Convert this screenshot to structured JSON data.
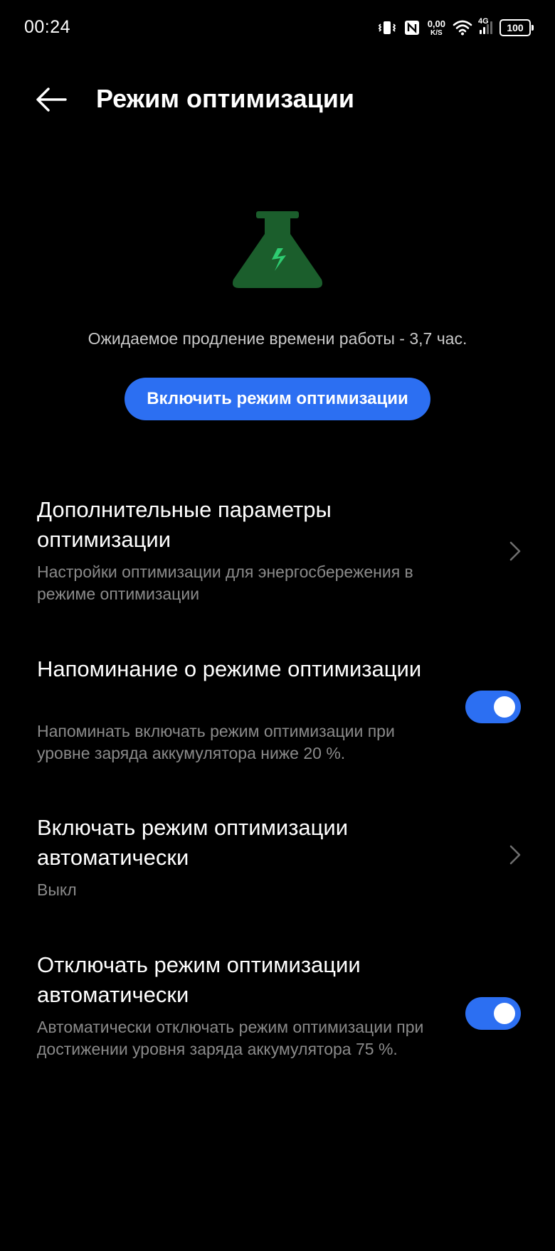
{
  "status_bar": {
    "time": "00:24",
    "net_speed_value": "0,00",
    "net_speed_unit": "K/S",
    "network_type": "4G",
    "battery_level": "100",
    "icons": [
      "vibrate-icon",
      "nfc-icon",
      "wifi-icon",
      "cellular-signal-icon",
      "battery-icon"
    ]
  },
  "header": {
    "title": "Режим оптимизации",
    "back_icon": "arrow-left-icon"
  },
  "hero": {
    "icon": "flask-bolt-icon",
    "icon_color": "#1b5e2c",
    "bolt_color": "#2ecc71",
    "description": "Ожидаемое продление времени работы - 3,7 час.",
    "button_label": "Включить режим оптимизации",
    "accent_color": "#2c6ff2"
  },
  "settings": [
    {
      "title": "Дополнительные параметры оптимизации",
      "subtitle": "Настройки оптимизации для энергосбережения в режиме оптимизации",
      "control": "chevron"
    },
    {
      "title": "Напоминание о режиме оптимизации",
      "subtitle": "Напоминать включать режим оптимизации при уровне заряда аккумулятора ниже 20 %.",
      "control": "toggle",
      "enabled": true
    },
    {
      "title": "Включать режим оптимизации автоматически",
      "subtitle": "Выкл",
      "control": "chevron"
    },
    {
      "title": "Отключать режим оптимизации автоматически",
      "subtitle": "Автоматически отключать режим оптимизации при достижении уровня заряда аккумулятора 75 %.",
      "control": "toggle",
      "enabled": true
    }
  ]
}
